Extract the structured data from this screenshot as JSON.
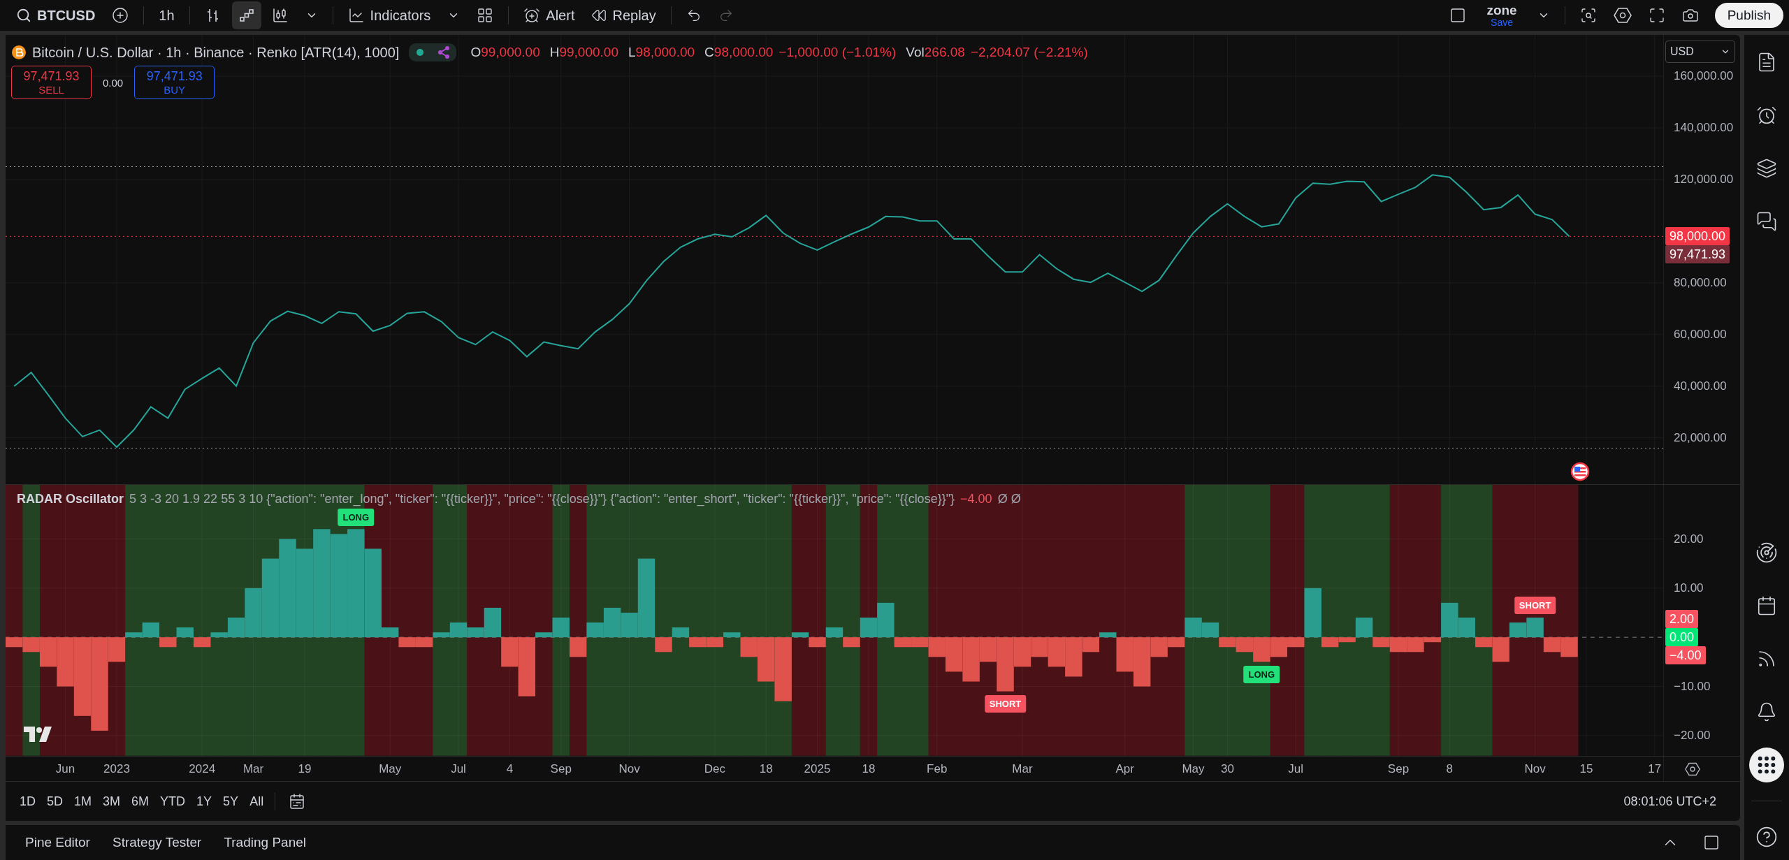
{
  "toolbar": {
    "symbol": "BTCUSD",
    "interval": "1h",
    "chart_types": [
      {
        "kind": "bars",
        "selected": false
      },
      {
        "kind": "renko",
        "selected": true
      },
      {
        "kind": "candles",
        "selected": false
      }
    ],
    "indicators": "Indicators",
    "alert": "Alert",
    "replay": "Replay",
    "undo": {
      "disabled": false
    },
    "redo": {
      "disabled": true
    },
    "layout": {
      "name": "zone",
      "status": "Save"
    },
    "publish": "Publish"
  },
  "legend": {
    "title": "Bitcoin / U.S. Dollar · 1h · Binance · Renko [ATR(14), 1000]",
    "ohlc": [
      {
        "label": "O",
        "value": "99,000.00"
      },
      {
        "label": "H",
        "value": "99,000.00"
      },
      {
        "label": "L",
        "value": "98,000.00"
      },
      {
        "label": "C",
        "value": "98,000.00"
      }
    ],
    "change": "−1,000.00 (−1.01%)",
    "volume": {
      "label": "Vol",
      "value": "266.08",
      "change": "−2,204.07 (−2.21%)"
    },
    "sell": {
      "price": "97,471.93",
      "label": "SELL"
    },
    "spread": "0.00",
    "buy": {
      "price": "97,471.93",
      "label": "BUY"
    }
  },
  "currency": "USD",
  "price": {
    "chart_data": {
      "type": "line",
      "ylim": [
        2000,
        176000
      ],
      "series": [
        {
          "color": "#26a69a",
          "values": [
            40000,
            45300,
            36600,
            27600,
            20500,
            23000,
            16400,
            23000,
            32000,
            27600,
            38800,
            43000,
            47000,
            40000,
            56800,
            65200,
            69000,
            67300,
            64300,
            68800,
            68000,
            61300,
            63500,
            68200,
            68800,
            65000,
            58800,
            56100,
            61000,
            57700,
            51400,
            57100,
            55700,
            54500,
            61000,
            65800,
            71900,
            80800,
            88200,
            93800,
            97000,
            98800,
            97800,
            101300,
            106100,
            99300,
            95300,
            92700,
            95900,
            98900,
            101600,
            105700,
            105500,
            104000,
            104000,
            97000,
            97000,
            90400,
            84200,
            84200,
            90900,
            85500,
            81400,
            80200,
            83700,
            80200,
            76700,
            81000,
            90400,
            99300,
            105700,
            110600,
            105700,
            101700,
            102800,
            112900,
            118600,
            118200,
            119300,
            119100,
            111500,
            114300,
            117000,
            121800,
            120900,
            115000,
            108300,
            109200,
            114000,
            106600,
            104500,
            98000,
            null,
            null,
            null,
            null,
            null
          ]
        }
      ],
      "yticks": [
        {
          "value": 160000,
          "label": "160,000.00"
        },
        {
          "value": 140000,
          "label": "140,000.00"
        },
        {
          "value": 120000,
          "label": "120,000.00"
        },
        {
          "value": 80000,
          "label": "80,000.00"
        },
        {
          "value": 60000,
          "label": "60,000.00"
        },
        {
          "value": 40000,
          "label": "40,000.00"
        },
        {
          "value": 20000,
          "label": "20,000.00"
        }
      ],
      "grid": true,
      "ref_lines": [
        {
          "axis": "y",
          "value": 125000,
          "color": "#9598a1"
        },
        {
          "axis": "y",
          "value": 16000,
          "color": "#9598a1"
        },
        {
          "axis": "y",
          "value": 98000,
          "color": "#f23645"
        }
      ]
    },
    "badges": [
      {
        "text": "98,000.00",
        "color": "#f23645"
      },
      {
        "text": "97,471.93",
        "color": "#7a2e3a"
      }
    ]
  },
  "oscillator": {
    "name": "RADAR Oscillator",
    "params": "5 3 -3 20 1.9 22 55 3 10 {\"action\": \"enter_long\", \"ticker\": \"{{ticker}}\", \"price\": \"{{close}}\"} {\"action\": \"enter_short\", \"ticker\": \"{{ticker}}\", \"price\": \"{{close}}\"}",
    "value": "−4.00",
    "extra": "Ø Ø",
    "chart_data": {
      "type": "bar",
      "ylim": [
        -24.1,
        31
      ],
      "grid": true,
      "categories": [
        null,
        null,
        null,
        "Jun",
        null,
        null,
        "2023",
        null,
        null,
        null,
        null,
        "2024",
        null,
        null,
        "Mar",
        null,
        null,
        "19",
        null,
        null,
        null,
        null,
        "May",
        null,
        null,
        null,
        "Jul",
        null,
        null,
        "4",
        null,
        null,
        "Sep",
        null,
        null,
        null,
        "Nov",
        null,
        null,
        null,
        null,
        "Dec",
        null,
        null,
        "18",
        null,
        null,
        "2025",
        null,
        null,
        "18",
        null,
        null,
        null,
        "Feb",
        null,
        null,
        null,
        null,
        "Mar",
        null,
        null,
        null,
        null,
        null,
        "Apr",
        null,
        null,
        null,
        "May",
        null,
        "30",
        null,
        null,
        null,
        "Jul",
        null,
        null,
        null,
        null,
        null,
        "Sep",
        null,
        null,
        "8",
        null,
        null,
        null,
        null,
        "Nov",
        null,
        null,
        "15",
        null,
        null,
        null,
        "17"
      ],
      "series": [
        {
          "color": "#2a9d8f",
          "values": [
            null,
            null,
            null,
            null,
            null,
            null,
            null,
            1,
            3,
            null,
            2,
            null,
            1,
            4,
            10,
            16,
            20,
            18,
            22,
            21,
            22,
            18,
            2,
            null,
            null,
            1,
            3,
            2,
            6,
            null,
            null,
            1,
            4,
            null,
            3,
            6,
            5,
            16,
            null,
            2,
            null,
            null,
            1,
            null,
            null,
            null,
            1,
            null,
            2,
            null,
            4,
            7,
            null,
            null,
            null,
            null,
            null,
            null,
            null,
            null,
            null,
            null,
            null,
            null,
            1,
            null,
            null,
            null,
            null,
            4,
            3,
            null,
            null,
            null,
            null,
            null,
            10,
            null,
            null,
            4,
            null,
            null,
            null,
            null,
            7,
            4,
            null,
            null,
            3,
            4,
            null,
            null,
            null,
            null,
            null,
            null,
            null
          ]
        },
        {
          "color": "#e0524c",
          "values": [
            -2,
            -3,
            -6,
            -10,
            -16,
            -19,
            -5,
            null,
            null,
            -2,
            null,
            -2,
            null,
            null,
            null,
            null,
            null,
            null,
            null,
            null,
            null,
            null,
            null,
            -2,
            -2,
            null,
            null,
            null,
            null,
            -6,
            -12,
            null,
            null,
            -4,
            null,
            null,
            null,
            null,
            -3,
            null,
            -2,
            -2,
            null,
            -4,
            -9,
            -13,
            null,
            -2,
            null,
            -2,
            null,
            null,
            -2,
            -2,
            -4,
            -7,
            -9,
            -5,
            -11,
            -6,
            -4,
            -6,
            -8,
            -3,
            null,
            -7,
            -10,
            -4,
            -2,
            null,
            null,
            -2,
            -3,
            -5,
            -4,
            -2,
            null,
            -2,
            -1,
            null,
            -2,
            -3,
            -3,
            -1,
            null,
            null,
            -2,
            -5,
            null,
            null,
            -3,
            -4,
            null,
            null,
            null,
            null,
            null
          ]
        }
      ],
      "yticks": [
        {
          "value": 20,
          "label": "20.00"
        },
        {
          "value": 10,
          "label": "10.00"
        },
        {
          "value": -10,
          "label": "−10.00"
        },
        {
          "value": -20,
          "label": "−20.00"
        }
      ],
      "ref_lines": [
        {
          "axis": "y",
          "value": 0,
          "color": "#787b86"
        }
      ]
    },
    "zones": [
      {
        "color": "#4a1217"
      },
      {
        "color": "#234423"
      },
      {
        "color": "#4a1217"
      },
      {
        "color": "#4a1217"
      },
      {
        "color": "#4a1217"
      },
      {
        "color": "#4a1217"
      },
      {
        "color": "#4a1217"
      },
      {
        "color": "#234423"
      },
      {
        "color": "#234423"
      },
      {
        "color": "#234423"
      },
      {
        "color": "#234423"
      },
      {
        "color": "#234423"
      },
      {
        "color": "#234423"
      },
      {
        "color": "#234423"
      },
      {
        "color": "#234423"
      },
      {
        "color": "#234423"
      },
      {
        "color": "#234423"
      },
      {
        "color": "#234423"
      },
      {
        "color": "#234423"
      },
      {
        "color": "#234423"
      },
      {
        "color": "#234423",
        "marker": {
          "text": "LONG",
          "kind": "long"
        }
      },
      {
        "color": "#4a1217"
      },
      {
        "color": "#4a1217"
      },
      {
        "color": "#4a1217"
      },
      {
        "color": "#4a1217"
      },
      {
        "color": "#234423"
      },
      {
        "color": "#234423"
      },
      {
        "color": "#4a1217"
      },
      {
        "color": "#4a1217"
      },
      {
        "color": "#4a1217"
      },
      {
        "color": "#4a1217"
      },
      {
        "color": "#4a1217"
      },
      {
        "color": "#234423"
      },
      {
        "color": "#4a1217"
      },
      {
        "color": "#234423"
      },
      {
        "color": "#234423"
      },
      {
        "color": "#234423"
      },
      {
        "color": "#234423"
      },
      {
        "color": "#234423"
      },
      {
        "color": "#234423"
      },
      {
        "color": "#234423"
      },
      {
        "color": "#234423"
      },
      {
        "color": "#234423"
      },
      {
        "color": "#234423"
      },
      {
        "color": "#234423"
      },
      {
        "color": "#234423"
      },
      {
        "color": "#4a1217"
      },
      {
        "color": "#4a1217"
      },
      {
        "color": "#234423"
      },
      {
        "color": "#234423"
      },
      {
        "color": "#4a1217"
      },
      {
        "color": "#234423"
      },
      {
        "color": "#234423"
      },
      {
        "color": "#234423"
      },
      {
        "color": "#4a1217"
      },
      {
        "color": "#4a1217"
      },
      {
        "color": "#4a1217"
      },
      {
        "color": "#4a1217"
      },
      {
        "color": "#4a1217",
        "marker": {
          "text": "SHORT",
          "kind": "short"
        }
      },
      {
        "color": "#4a1217"
      },
      {
        "color": "#4a1217"
      },
      {
        "color": "#4a1217"
      },
      {
        "color": "#4a1217"
      },
      {
        "color": "#4a1217"
      },
      {
        "color": "#4a1217"
      },
      {
        "color": "#4a1217"
      },
      {
        "color": "#4a1217"
      },
      {
        "color": "#4a1217"
      },
      {
        "color": "#4a1217"
      },
      {
        "color": "#234423"
      },
      {
        "color": "#234423"
      },
      {
        "color": "#234423"
      },
      {
        "color": "#234423"
      },
      {
        "color": "#234423",
        "marker": {
          "text": "LONG",
          "kind": "long"
        }
      },
      {
        "color": "#4a1217"
      },
      {
        "color": "#4a1217"
      },
      {
        "color": "#234423"
      },
      {
        "color": "#234423"
      },
      {
        "color": "#234423"
      },
      {
        "color": "#234423"
      },
      {
        "color": "#234423"
      },
      {
        "color": "#4a1217"
      },
      {
        "color": "#4a1217"
      },
      {
        "color": "#4a1217"
      },
      {
        "color": "#234423"
      },
      {
        "color": "#234423"
      },
      {
        "color": "#234423"
      },
      {
        "color": "#4a1217"
      },
      {
        "color": "#4a1217"
      },
      {
        "color": "#4a1217",
        "marker": {
          "text": "SHORT",
          "kind": "short"
        }
      },
      {
        "color": "#4a1217"
      },
      {
        "color": "#4a1217"
      }
    ],
    "badges": [
      {
        "text": "2.00",
        "color": "#f7525f"
      },
      {
        "text": "0.00",
        "color": "#00e676"
      },
      {
        "text": "−4.00",
        "color": "#f7525f"
      }
    ]
  },
  "ranges": [
    "1D",
    "5D",
    "1M",
    "3M",
    "6M",
    "YTD",
    "1Y",
    "5Y",
    "All"
  ],
  "clock": "08:01:06 UTC+2",
  "bottom_tabs": [
    "Pine Editor",
    "Strategy Tester",
    "Trading Panel"
  ]
}
